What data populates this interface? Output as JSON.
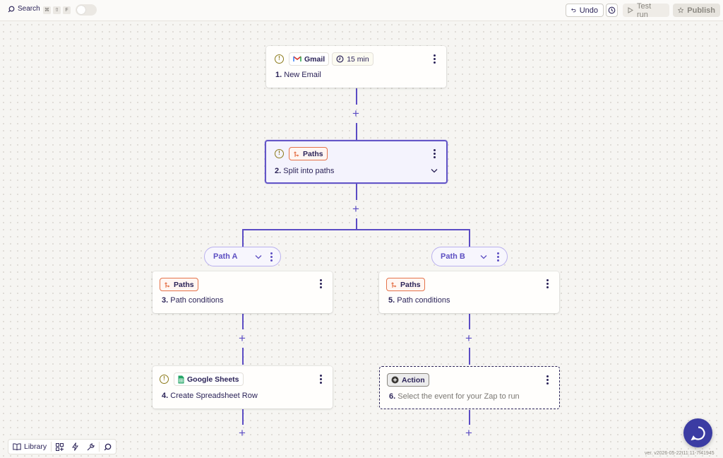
{
  "toolbar": {
    "search_label": "Search",
    "shortcut_keys": [
      "⌘",
      "⇧",
      "F"
    ],
    "undo_label": "Undo",
    "test_run_label": "Test run",
    "publish_label": "Publish"
  },
  "steps": {
    "s1": {
      "app": "Gmail",
      "timer": "15 min",
      "number": "1.",
      "title": "New Email"
    },
    "s2": {
      "app": "Paths",
      "number": "2.",
      "title": "Split into paths"
    },
    "s3": {
      "app": "Paths",
      "number": "3.",
      "title": "Path conditions"
    },
    "s4": {
      "app": "Google Sheets",
      "number": "4.",
      "title": "Create Spreadsheet Row"
    },
    "s5": {
      "app": "Paths",
      "number": "5.",
      "title": "Path conditions"
    },
    "s6": {
      "app": "Action",
      "number": "6.",
      "title": "Select the event for your Zap to run"
    }
  },
  "paths": {
    "a": "Path A",
    "b": "Path B"
  },
  "bottom": {
    "library_label": "Library"
  },
  "version": "ver. v2026-05-22t11:11-7f41945",
  "colors": {
    "accent": "#5b4cc4",
    "paths_orange": "#e5734a",
    "chat": "#3b3ca3"
  }
}
